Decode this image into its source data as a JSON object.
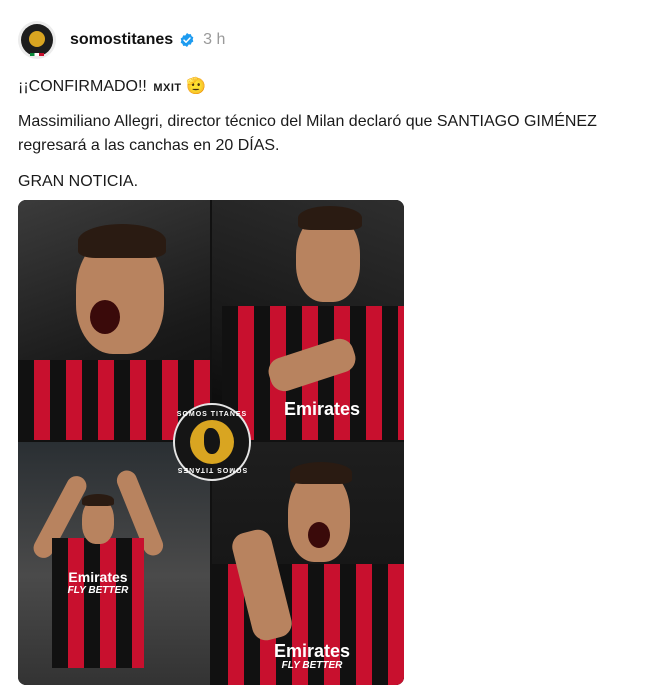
{
  "post": {
    "username": "somostitanes",
    "time": "3 h",
    "avatar_icon": "somos-titanes-logo-icon",
    "verified_icon": "verified-badge-icon",
    "verified_color": "#1d9bf0",
    "line1_text": "¡¡CONFIRMADO!!",
    "line1_tag": "MXIT",
    "line1_emoji": "🫡",
    "body_line2": "Massimiliano Allegri, director técnico del Milan declaró que SANTIAGO GIMÉNEZ",
    "body_line3": "regresará a las canchas en 20 DÍAS.",
    "body_line4": "GRAN NOTICIA."
  },
  "collage": {
    "sponsor_name": "Emirates",
    "sponsor_tagline": "FLY BETTER",
    "watermark_top": "SOMOS TITANES",
    "watermark_bottom": "SOMOS TITANES",
    "kit_colors": [
      "#c8102e",
      "#111111"
    ]
  }
}
